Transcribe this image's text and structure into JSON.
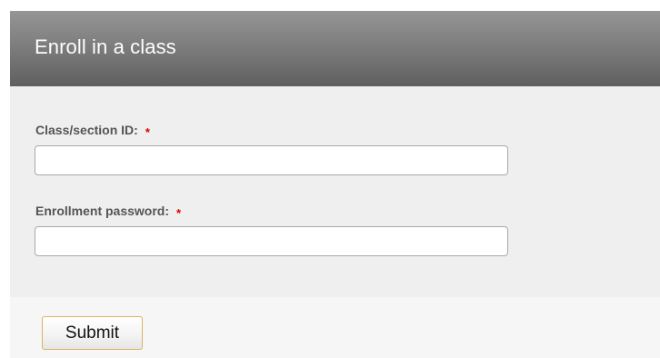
{
  "header": {
    "title": "Enroll in a class"
  },
  "form": {
    "fields": [
      {
        "label": "Class/section ID:",
        "required_marker": "*",
        "value": "",
        "placeholder": ""
      },
      {
        "label": "Enrollment password:",
        "required_marker": "*",
        "value": "",
        "placeholder": ""
      }
    ],
    "submit_label": "Submit"
  },
  "colors": {
    "header_gradient_top": "#959595",
    "header_gradient_bottom": "#5f5f5f",
    "panel_background": "#efefef",
    "required_marker": "#dd0000",
    "submit_border": "#d8b560"
  }
}
